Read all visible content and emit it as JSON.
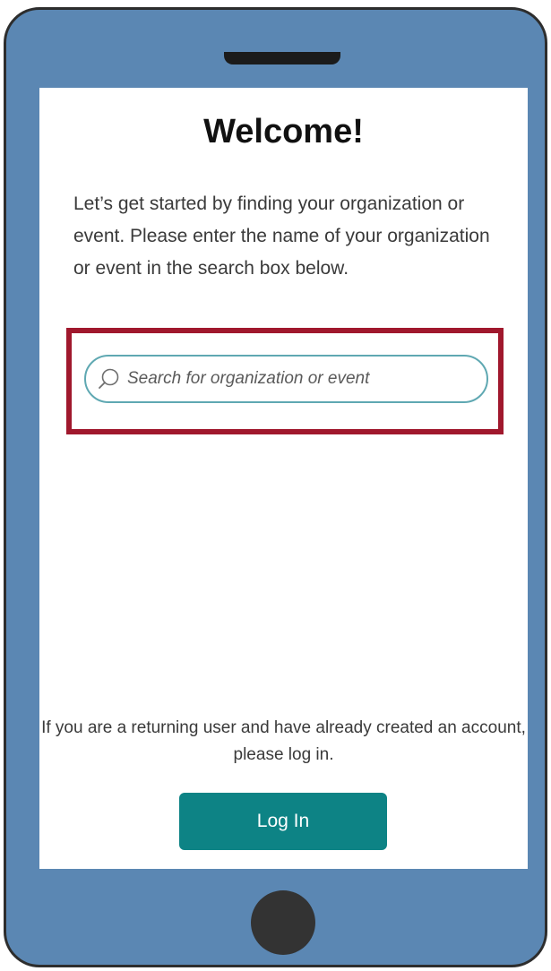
{
  "screen": {
    "title": "Welcome!",
    "intro_text": "Let’s get started by finding your organization or event. Please enter the name of your organization or event in the search box below.",
    "search": {
      "placeholder": "Search for organization or event",
      "value": "",
      "icon": "search-icon"
    },
    "returning_user_text": "If you are a returning user and have already created an account, please log in.",
    "login_label": "Log In"
  },
  "colors": {
    "phone_body": "#5b87b3",
    "phone_border": "#2d2d2d",
    "highlight": "#a0182d",
    "search_border": "#5fa8b2",
    "button": "#0d8385"
  }
}
